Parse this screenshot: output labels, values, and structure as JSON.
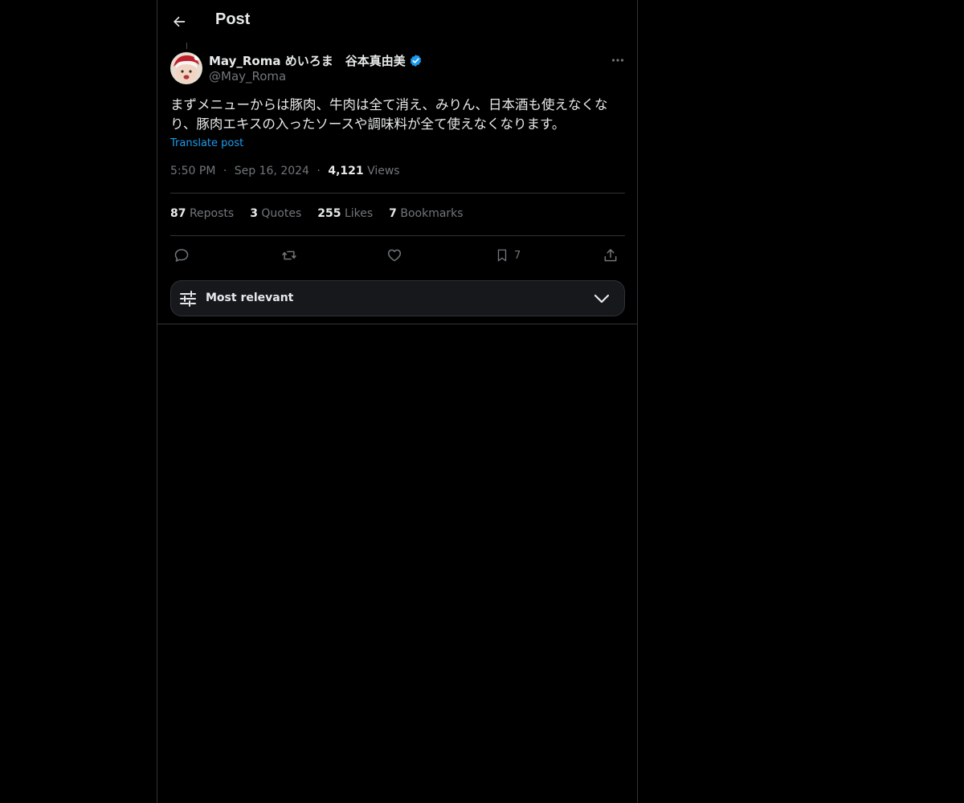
{
  "header": {
    "title": "Post",
    "back_icon": "arrow-left-icon"
  },
  "post": {
    "author": {
      "display_name": "May_Roma めいろま　谷本真由美",
      "handle": "@May_Roma",
      "verified": true,
      "verified_color": "#1d9bf0"
    },
    "text": "まずメニューからは豚肉、牛肉は全て消え、みりん、日本酒も使えなくなり、豚肉エキスの入ったソースや調味料が全て使えなくなります。",
    "translate_label": "Translate post",
    "time": "5:50 PM",
    "separator": "·",
    "date": "Sep 16, 2024",
    "views_count": "4,121",
    "views_label": "Views"
  },
  "stats": {
    "reposts": {
      "count": "87",
      "label": "Reposts"
    },
    "quotes": {
      "count": "3",
      "label": "Quotes"
    },
    "likes": {
      "count": "255",
      "label": "Likes"
    },
    "bookmarks": {
      "count": "7",
      "label": "Bookmarks"
    }
  },
  "actions": {
    "reply_icon": "reply-icon",
    "repost_icon": "repost-icon",
    "like_icon": "heart-icon",
    "bookmark_icon": "bookmark-icon",
    "bookmark_count": "7",
    "share_icon": "share-icon"
  },
  "sort": {
    "label": "Most relevant"
  },
  "colors": {
    "background": "#000000",
    "text": "#e7e9ea",
    "muted": "#71767b",
    "accent": "#1d9bf0",
    "border": "#2f3336"
  }
}
